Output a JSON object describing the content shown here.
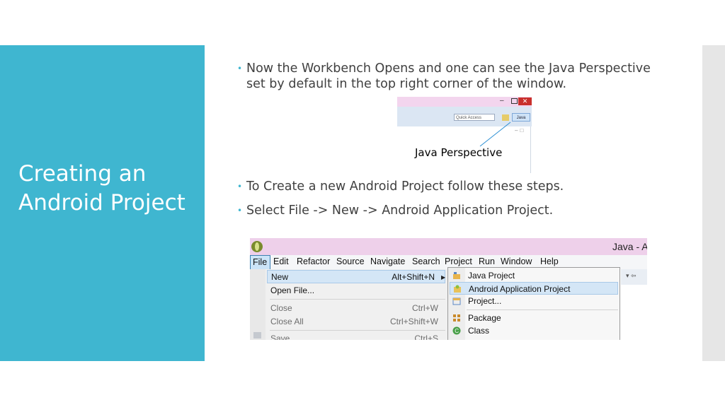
{
  "slide": {
    "title": "Creating an Android Project",
    "colors": {
      "accent": "#3fb6d0",
      "text": "#404040",
      "side_strip": "#e6e6e6"
    }
  },
  "bullets": [
    "Now the Workbench Opens and one can see the Java Perspective set by default in the top right corner of the window.",
    "To Create a new Android Project follow these steps.",
    "Select File -> New -> Android Application Project."
  ],
  "perspective_screenshot": {
    "quick_access": "Quick Access",
    "java_button": "Java",
    "caption": "Java Perspective",
    "close_glyph": "✕",
    "minimize_glyph": "–"
  },
  "eclipse_screenshot": {
    "window_title": "Java - A",
    "menubar": [
      "File",
      "Edit",
      "Refactor",
      "Source",
      "Navigate",
      "Search",
      "Project",
      "Run",
      "Window",
      "Help"
    ],
    "file_menu": [
      {
        "label": "New",
        "accel": "Alt+Shift+N",
        "state": "highlighted"
      },
      {
        "label": "Open File...",
        "accel": "",
        "state": "normal"
      },
      {
        "label": "Close",
        "accel": "Ctrl+W",
        "state": "disabled"
      },
      {
        "label": "Close All",
        "accel": "Ctrl+Shift+W",
        "state": "disabled"
      },
      {
        "label": "Save",
        "accel": "Ctrl+S",
        "state": "disabled"
      }
    ],
    "new_submenu": [
      {
        "label": "Java Project",
        "icon": "java-project-icon",
        "state": "normal"
      },
      {
        "label": "Android Application Project",
        "icon": "android-project-icon",
        "state": "highlighted"
      },
      {
        "label": "Project...",
        "icon": "project-icon",
        "state": "normal"
      },
      {
        "label": "Package",
        "icon": "package-icon",
        "state": "normal"
      },
      {
        "label": "Class",
        "icon": "class-icon",
        "state": "normal"
      }
    ]
  }
}
